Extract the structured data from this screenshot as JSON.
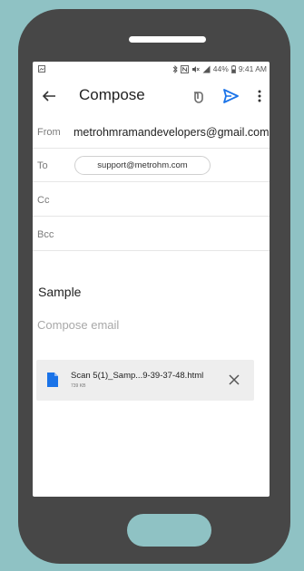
{
  "status_bar": {
    "battery": "44%",
    "time": "9:41 AM"
  },
  "appbar": {
    "title": "Compose",
    "icons": [
      "back-arrow-icon",
      "attachment-icon",
      "send-icon",
      "more-vert-icon"
    ]
  },
  "fields": {
    "from_label": "From",
    "from_value": "metrohmramandevelopers@gmail.com",
    "to_label": "To",
    "to_chip": "support@metrohm.com",
    "cc_label": "Cc",
    "bcc_label": "Bcc"
  },
  "subject": "Sample",
  "body_placeholder": "Compose email",
  "attachment": {
    "name": "Scan 5(1)_Samp...9-39-37-48.html",
    "size": "739 KB"
  },
  "colors": {
    "background": "#8fc2c4",
    "phone": "#474747",
    "accent": "#1a73e8"
  }
}
